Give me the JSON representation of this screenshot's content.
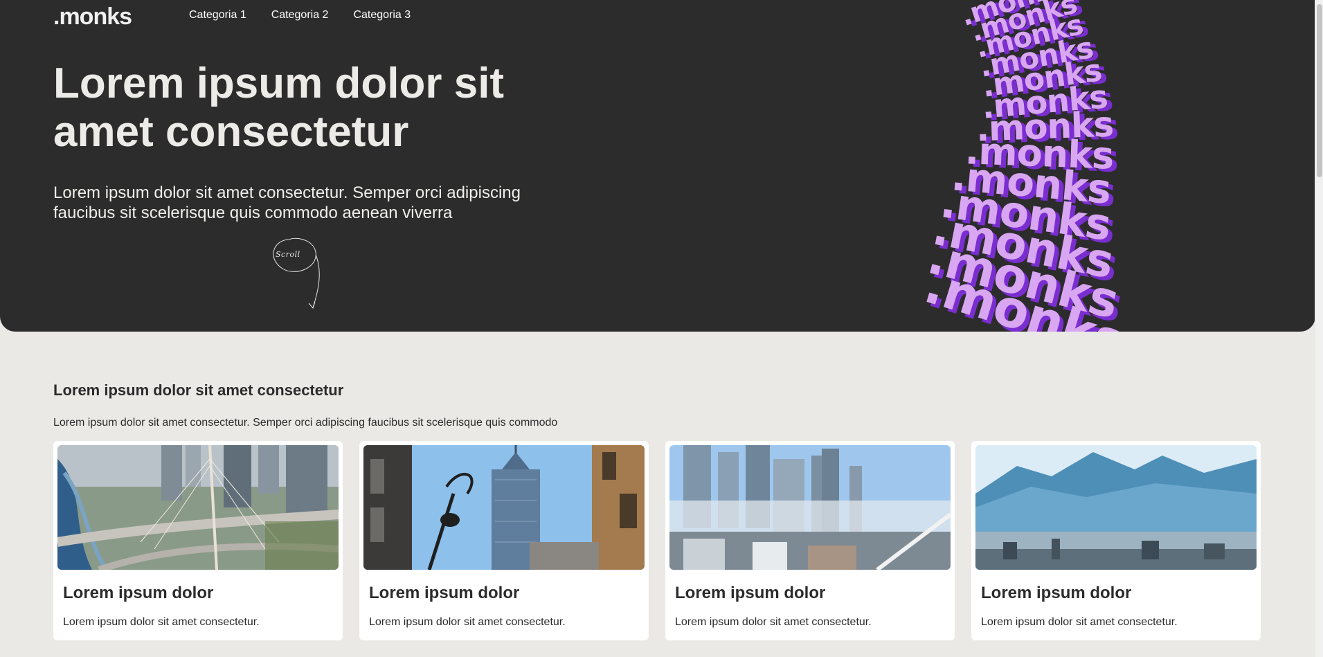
{
  "header": {
    "logo": ".monks",
    "nav": [
      "Categoria 1",
      "Categoria 2",
      "Categoria 3"
    ]
  },
  "hero": {
    "title": "Lorem ipsum dolor sit amet consectetur",
    "subtitle": "Lorem ipsum dolor sit amet consectetur. Semper orci adipiscing faucibus sit scelerisque quis commodo aenean viverra",
    "scroll_label": "Scroll",
    "wave_word": ".monks"
  },
  "section": {
    "title": "Lorem ipsum dolor sit amet consectetur",
    "description": "Lorem ipsum dolor sit amet consectetur. Semper orci adipiscing faucibus sit scelerisque quis commodo"
  },
  "cards": [
    {
      "title": "Lorem ipsum dolor",
      "text": "Lorem ipsum dolor sit amet consectetur."
    },
    {
      "title": "Lorem ipsum dolor",
      "text": "Lorem ipsum dolor sit amet consectetur."
    },
    {
      "title": "Lorem ipsum dolor",
      "text": "Lorem ipsum dolor sit amet consectetur."
    },
    {
      "title": "Lorem ipsum dolor",
      "text": "Lorem ipsum dolor sit amet consectetur."
    }
  ],
  "colors": {
    "hero_bg": "#2c2c2c",
    "page_bg": "#ebe9e6",
    "accent_light": "#d9a6f2",
    "accent_dark": "#7a2ed0"
  }
}
